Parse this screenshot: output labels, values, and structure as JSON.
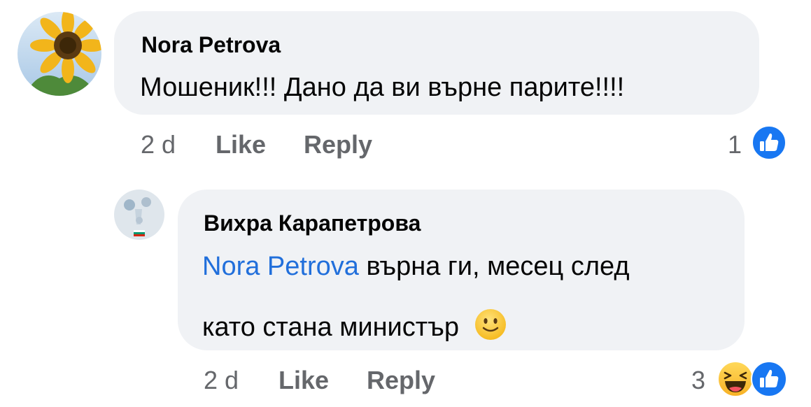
{
  "comments": [
    {
      "author": "Nora Petrova",
      "text": "Мошеник!!! Дано да ви върне парите!!!!",
      "time": "2 d",
      "like_label": "Like",
      "reply_label": "Reply",
      "reaction_count": "1",
      "reactions": [
        "like-icon"
      ]
    },
    {
      "author": "Вихра Карапетрова",
      "mention": "Nora Petrova",
      "text_line1": " върна ги, месец след",
      "text_line2": "като стана министър",
      "emoji": "slightly-smiling-face-icon",
      "time": "2 d",
      "like_label": "Like",
      "reply_label": "Reply",
      "reaction_count": "3",
      "reactions": [
        "haha-icon",
        "like-icon"
      ]
    }
  ],
  "colors": {
    "bubble": "#f0f2f5",
    "text": "#050505",
    "meta": "#65676b",
    "mention": "#216fdb",
    "like_blue": "#1877f2"
  }
}
